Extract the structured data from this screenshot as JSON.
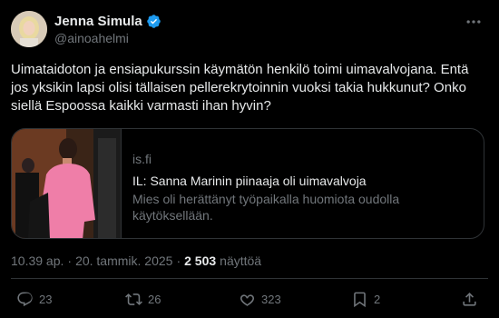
{
  "author": {
    "display_name": "Jenna Simula",
    "handle": "@ainoahelmi",
    "verified": true,
    "verified_color": "#1d9bf0"
  },
  "tweet": {
    "text": "Uimataidoton ja ensiapukurssin käymätön henkilö toimi uimavalvojana. Entä jos yksikin lapsi olisi tällaisen pellerekrytoinnin vuoksi takia hukkunut? Onko siellä Espoossa kaikki varmasti ihan hyvin?"
  },
  "card": {
    "domain": "is.fi",
    "title": "IL: Sanna Marinin piinaaja oli uimavalvoja",
    "description": "Mies oli herättänyt työpaikalla huomiota oudolla käytöksellään."
  },
  "meta": {
    "time": "10.39 ap.",
    "separator": "·",
    "date": "20. tammik. 2025",
    "separator2": "·",
    "views_count": "2 503",
    "views_label": "näyttöä"
  },
  "actions": {
    "replies": "23",
    "reposts": "26",
    "likes": "323",
    "bookmarks": "2"
  },
  "icons": {
    "more": "more-icon",
    "reply": "reply-icon",
    "repost": "repost-icon",
    "like": "heart-icon",
    "bookmark": "bookmark-icon",
    "share": "share-icon",
    "verified": "verified-badge-icon"
  },
  "colors": {
    "background": "#000000",
    "text": "#e7e9ea",
    "muted": "#71767b",
    "border": "#2f3336"
  }
}
